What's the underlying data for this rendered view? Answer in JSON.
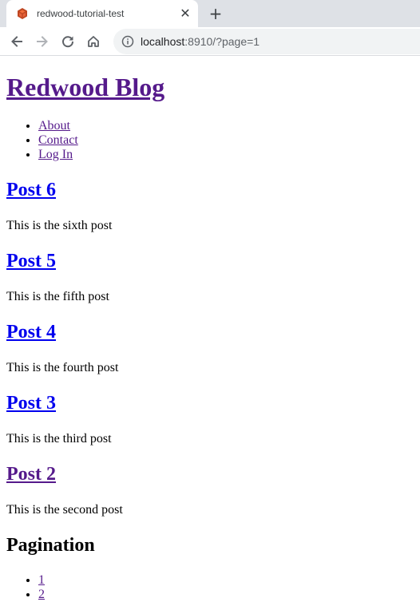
{
  "browser": {
    "tab_title": "redwood-tutorial-test",
    "close_glyph": "✕",
    "new_tab_glyph": "+",
    "url_host": "localhost",
    "url_rest": ":8910/?page=1"
  },
  "site": {
    "title": "Redwood Blog",
    "nav": [
      {
        "label": "About"
      },
      {
        "label": "Contact"
      },
      {
        "label": "Log In"
      }
    ]
  },
  "posts": [
    {
      "title": "Post 6",
      "body": "This is the sixth post"
    },
    {
      "title": "Post 5",
      "body": "This is the fifth post"
    },
    {
      "title": "Post 4",
      "body": "This is the fourth post"
    },
    {
      "title": "Post 3",
      "body": "This is the third post"
    },
    {
      "title": "Post 2",
      "body": "This is the second post"
    }
  ],
  "pagination": {
    "heading": "Pagination",
    "pages": [
      {
        "label": "1"
      },
      {
        "label": "2"
      }
    ]
  },
  "colors": {
    "link": "#0000ee",
    "visited_link": "#551a8b",
    "tabstrip": "#dee1e6",
    "omnibox": "#f1f3f4",
    "favicon": "#bf4722"
  },
  "icons": {
    "favicon": "redwood-logo-icon",
    "tab_close": "close-icon",
    "new_tab": "plus-icon",
    "back": "arrow-left-icon",
    "forward": "arrow-right-icon",
    "reload": "reload-icon",
    "home": "home-icon",
    "site_info": "info-icon"
  }
}
